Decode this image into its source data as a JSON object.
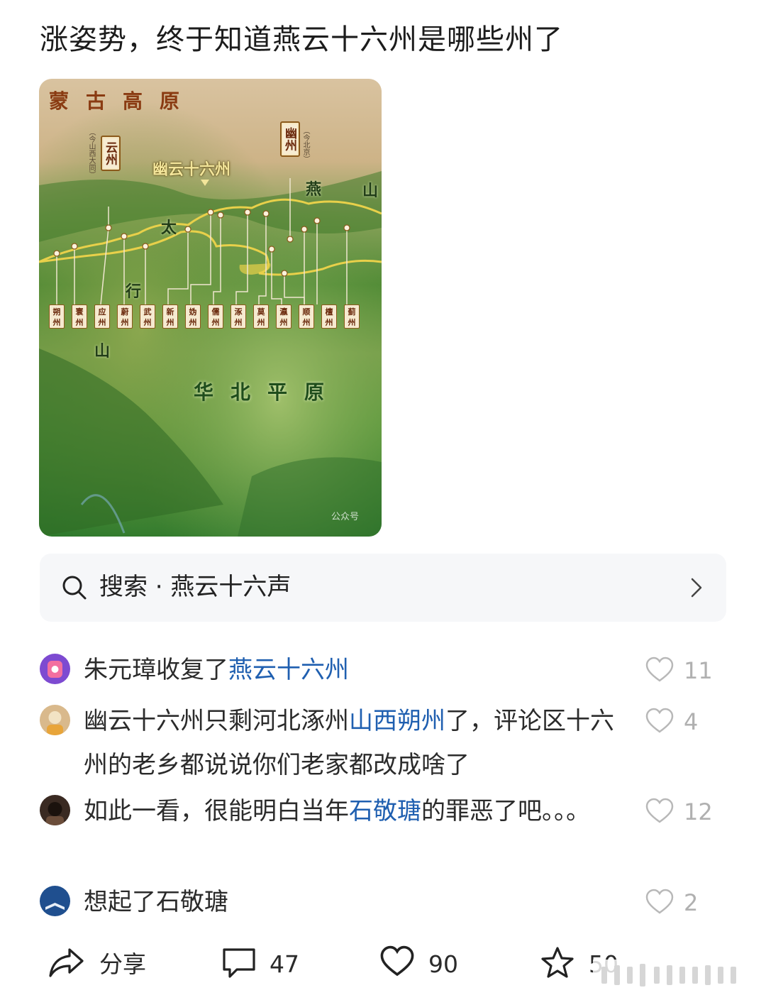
{
  "post": {
    "title": "涨姿势，终于知道燕云十六州是哪些州了"
  },
  "map_image": {
    "region_top": "蒙古高原",
    "region_bottom": "华北平原",
    "heading": "幽云十六州",
    "callout_left": {
      "name": "云州",
      "note": "（今山西大同）"
    },
    "callout_right": {
      "name": "幽州",
      "note": "（今北京）"
    },
    "mountains": [
      "太",
      "行",
      "山",
      "燕",
      "山"
    ],
    "prefectures": [
      "朔州",
      "寰州",
      "应州",
      "蔚州",
      "武州",
      "新州",
      "妫州",
      "儒州",
      "涿州",
      "莫州",
      "瀛州",
      "顺州",
      "檀州",
      "蓟州"
    ],
    "watermark": "公众号"
  },
  "search": {
    "label": "搜索 · 燕云十六声"
  },
  "comments": [
    {
      "before": "朱元璋收复了",
      "highlight": "燕云十六州",
      "after": "",
      "likes": "11"
    },
    {
      "before": "幽云十六州只剩河北涿州",
      "highlight": "山西朔州",
      "after": "了，评论区十六州的老乡都说说你们老家都改成啥了",
      "likes": "4"
    },
    {
      "before": "如此一看，很能明白当年",
      "highlight": "石敬瑭",
      "after": "的罪恶了吧。。。",
      "likes": "12"
    },
    {
      "before": "想起了石敬瑭",
      "highlight": "",
      "after": "",
      "likes": "2"
    }
  ],
  "actions": {
    "share_label": "分享",
    "comment_count": "47",
    "like_count": "90",
    "fav_count": "50"
  },
  "colors": {
    "highlight": "#1f5fb0",
    "like_gray": "#b0b0b0",
    "search_bg": "#f6f7f9"
  }
}
